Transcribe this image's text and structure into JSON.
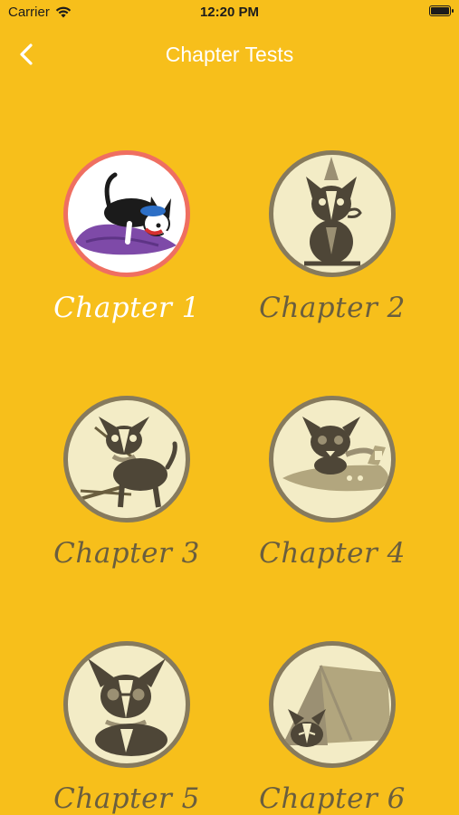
{
  "status_bar": {
    "carrier": "Carrier",
    "time": "12:20 PM"
  },
  "nav": {
    "title": "Chapter Tests",
    "back_icon": "chevron-left-icon"
  },
  "chapters": [
    {
      "label": "Chapter 1",
      "state": "active",
      "icon": "dog-stretching-on-pillow-icon"
    },
    {
      "label": "Chapter 2",
      "state": "locked",
      "icon": "dog-with-party-hat-icon"
    },
    {
      "label": "Chapter 3",
      "state": "locked",
      "icon": "dog-with-sticks-icon"
    },
    {
      "label": "Chapter 4",
      "state": "locked",
      "icon": "dog-on-airplane-icon"
    },
    {
      "label": "Chapter 5",
      "state": "locked",
      "icon": "dog-with-glasses-icon"
    },
    {
      "label": "Chapter 6",
      "state": "locked",
      "icon": "dog-in-tent-icon"
    }
  ],
  "colors": {
    "background": "#f7bf1b",
    "active_ring": "#ef6f61",
    "locked_ring": "#867a5d",
    "locked_text": "#6a5e3e",
    "active_text": "#ffffff"
  }
}
